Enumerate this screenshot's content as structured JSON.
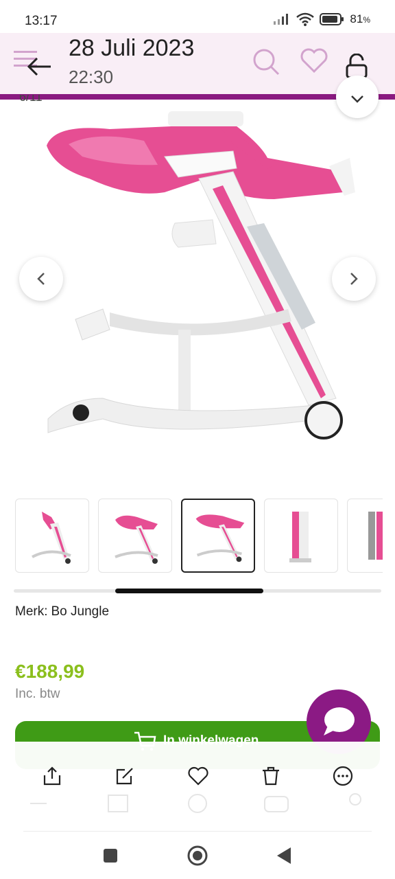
{
  "status_bar": {
    "time": "13:17",
    "battery": "81",
    "battery_unit": "%",
    "icons": [
      "signal-icon",
      "wifi-icon",
      "battery-icon"
    ]
  },
  "viewer": {
    "date": "28 Juli 2023",
    "time": "22:30",
    "back_icon": "back-arrow-icon",
    "unlock_icon": "unlock-icon"
  },
  "gallery": {
    "counter": "6/11",
    "selected_thumbnail": 3,
    "thumbnail_count": 5
  },
  "product": {
    "brand_label": "Merk:",
    "brand_name": "Bo Jungle",
    "price": "€188,99",
    "vat_note": "Inc. btw",
    "cart_button": "In winkelwagen",
    "accent_pink": "#e64e93",
    "price_color": "#8bbf1d",
    "button_color": "#3f9b16",
    "chat_color": "#8b1a84"
  },
  "toolbar": {
    "actions": [
      "share-icon",
      "edit-icon",
      "favorite-icon",
      "delete-icon",
      "more-icon"
    ]
  },
  "system_nav": {
    "buttons": [
      "recents-button",
      "home-button",
      "back-button"
    ]
  }
}
